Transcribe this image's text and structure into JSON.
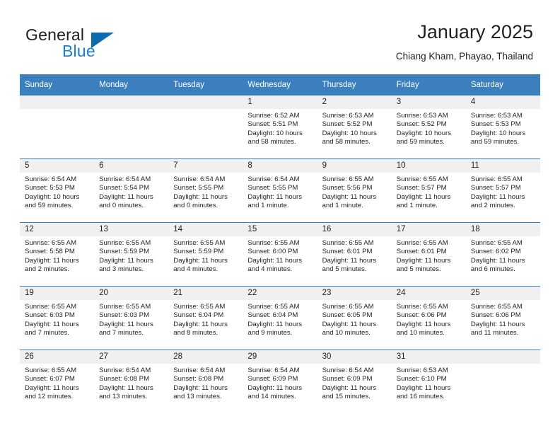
{
  "brand": {
    "word_one": "General",
    "word_two": "Blue",
    "logo_icon": "triangle-logo-icon",
    "accent_color": "#0d6cb0"
  },
  "header": {
    "title": "January 2025",
    "location": "Chiang Kham, Phayao, Thailand"
  },
  "theme": {
    "header_row_color": "#3b7fbe",
    "daynum_strip_color": "#f0f0f0",
    "text_color": "#231f20"
  },
  "calendar": {
    "weekdays": [
      "Sunday",
      "Monday",
      "Tuesday",
      "Wednesday",
      "Thursday",
      "Friday",
      "Saturday"
    ],
    "weeks": [
      [
        {
          "day": "",
          "empty": true,
          "lines": []
        },
        {
          "day": "",
          "empty": true,
          "lines": []
        },
        {
          "day": "",
          "empty": true,
          "lines": []
        },
        {
          "day": "1",
          "empty": false,
          "lines": [
            "Sunrise: 6:52 AM",
            "Sunset: 5:51 PM",
            "Daylight: 10 hours and 58 minutes."
          ]
        },
        {
          "day": "2",
          "empty": false,
          "lines": [
            "Sunrise: 6:53 AM",
            "Sunset: 5:52 PM",
            "Daylight: 10 hours and 58 minutes."
          ]
        },
        {
          "day": "3",
          "empty": false,
          "lines": [
            "Sunrise: 6:53 AM",
            "Sunset: 5:52 PM",
            "Daylight: 10 hours and 59 minutes."
          ]
        },
        {
          "day": "4",
          "empty": false,
          "lines": [
            "Sunrise: 6:53 AM",
            "Sunset: 5:53 PM",
            "Daylight: 10 hours and 59 minutes."
          ]
        }
      ],
      [
        {
          "day": "5",
          "empty": false,
          "lines": [
            "Sunrise: 6:54 AM",
            "Sunset: 5:53 PM",
            "Daylight: 10 hours and 59 minutes."
          ]
        },
        {
          "day": "6",
          "empty": false,
          "lines": [
            "Sunrise: 6:54 AM",
            "Sunset: 5:54 PM",
            "Daylight: 11 hours and 0 minutes."
          ]
        },
        {
          "day": "7",
          "empty": false,
          "lines": [
            "Sunrise: 6:54 AM",
            "Sunset: 5:55 PM",
            "Daylight: 11 hours and 0 minutes."
          ]
        },
        {
          "day": "8",
          "empty": false,
          "lines": [
            "Sunrise: 6:54 AM",
            "Sunset: 5:55 PM",
            "Daylight: 11 hours and 1 minute."
          ]
        },
        {
          "day": "9",
          "empty": false,
          "lines": [
            "Sunrise: 6:55 AM",
            "Sunset: 5:56 PM",
            "Daylight: 11 hours and 1 minute."
          ]
        },
        {
          "day": "10",
          "empty": false,
          "lines": [
            "Sunrise: 6:55 AM",
            "Sunset: 5:57 PM",
            "Daylight: 11 hours and 1 minute."
          ]
        },
        {
          "day": "11",
          "empty": false,
          "lines": [
            "Sunrise: 6:55 AM",
            "Sunset: 5:57 PM",
            "Daylight: 11 hours and 2 minutes."
          ]
        }
      ],
      [
        {
          "day": "12",
          "empty": false,
          "lines": [
            "Sunrise: 6:55 AM",
            "Sunset: 5:58 PM",
            "Daylight: 11 hours and 2 minutes."
          ]
        },
        {
          "day": "13",
          "empty": false,
          "lines": [
            "Sunrise: 6:55 AM",
            "Sunset: 5:59 PM",
            "Daylight: 11 hours and 3 minutes."
          ]
        },
        {
          "day": "14",
          "empty": false,
          "lines": [
            "Sunrise: 6:55 AM",
            "Sunset: 5:59 PM",
            "Daylight: 11 hours and 4 minutes."
          ]
        },
        {
          "day": "15",
          "empty": false,
          "lines": [
            "Sunrise: 6:55 AM",
            "Sunset: 6:00 PM",
            "Daylight: 11 hours and 4 minutes."
          ]
        },
        {
          "day": "16",
          "empty": false,
          "lines": [
            "Sunrise: 6:55 AM",
            "Sunset: 6:01 PM",
            "Daylight: 11 hours and 5 minutes."
          ]
        },
        {
          "day": "17",
          "empty": false,
          "lines": [
            "Sunrise: 6:55 AM",
            "Sunset: 6:01 PM",
            "Daylight: 11 hours and 5 minutes."
          ]
        },
        {
          "day": "18",
          "empty": false,
          "lines": [
            "Sunrise: 6:55 AM",
            "Sunset: 6:02 PM",
            "Daylight: 11 hours and 6 minutes."
          ]
        }
      ],
      [
        {
          "day": "19",
          "empty": false,
          "lines": [
            "Sunrise: 6:55 AM",
            "Sunset: 6:03 PM",
            "Daylight: 11 hours and 7 minutes."
          ]
        },
        {
          "day": "20",
          "empty": false,
          "lines": [
            "Sunrise: 6:55 AM",
            "Sunset: 6:03 PM",
            "Daylight: 11 hours and 7 minutes."
          ]
        },
        {
          "day": "21",
          "empty": false,
          "lines": [
            "Sunrise: 6:55 AM",
            "Sunset: 6:04 PM",
            "Daylight: 11 hours and 8 minutes."
          ]
        },
        {
          "day": "22",
          "empty": false,
          "lines": [
            "Sunrise: 6:55 AM",
            "Sunset: 6:04 PM",
            "Daylight: 11 hours and 9 minutes."
          ]
        },
        {
          "day": "23",
          "empty": false,
          "lines": [
            "Sunrise: 6:55 AM",
            "Sunset: 6:05 PM",
            "Daylight: 11 hours and 10 minutes."
          ]
        },
        {
          "day": "24",
          "empty": false,
          "lines": [
            "Sunrise: 6:55 AM",
            "Sunset: 6:06 PM",
            "Daylight: 11 hours and 10 minutes."
          ]
        },
        {
          "day": "25",
          "empty": false,
          "lines": [
            "Sunrise: 6:55 AM",
            "Sunset: 6:06 PM",
            "Daylight: 11 hours and 11 minutes."
          ]
        }
      ],
      [
        {
          "day": "26",
          "empty": false,
          "lines": [
            "Sunrise: 6:55 AM",
            "Sunset: 6:07 PM",
            "Daylight: 11 hours and 12 minutes."
          ]
        },
        {
          "day": "27",
          "empty": false,
          "lines": [
            "Sunrise: 6:54 AM",
            "Sunset: 6:08 PM",
            "Daylight: 11 hours and 13 minutes."
          ]
        },
        {
          "day": "28",
          "empty": false,
          "lines": [
            "Sunrise: 6:54 AM",
            "Sunset: 6:08 PM",
            "Daylight: 11 hours and 13 minutes."
          ]
        },
        {
          "day": "29",
          "empty": false,
          "lines": [
            "Sunrise: 6:54 AM",
            "Sunset: 6:09 PM",
            "Daylight: 11 hours and 14 minutes."
          ]
        },
        {
          "day": "30",
          "empty": false,
          "lines": [
            "Sunrise: 6:54 AM",
            "Sunset: 6:09 PM",
            "Daylight: 11 hours and 15 minutes."
          ]
        },
        {
          "day": "31",
          "empty": false,
          "lines": [
            "Sunrise: 6:53 AM",
            "Sunset: 6:10 PM",
            "Daylight: 11 hours and 16 minutes."
          ]
        },
        {
          "day": "",
          "empty": true,
          "lines": []
        }
      ]
    ]
  }
}
